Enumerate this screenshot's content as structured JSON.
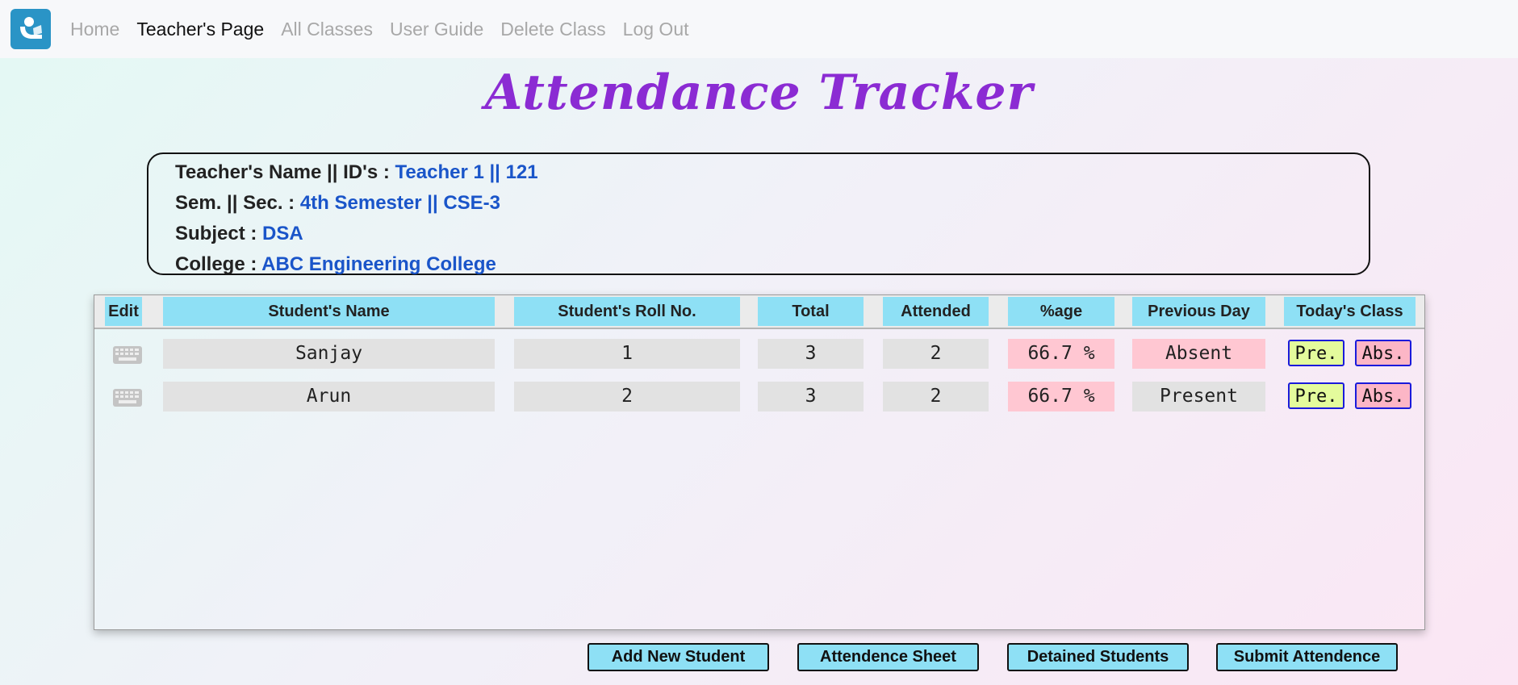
{
  "nav": {
    "home": "Home",
    "teachers_page": "Teacher's Page",
    "all_classes": "All Classes",
    "user_guide": "User Guide",
    "delete_class": "Delete Class",
    "log_out": "Log Out"
  },
  "page_title": "Attendance Tracker",
  "info": {
    "teacher_label": "Teacher's Name || ID's : ",
    "teacher_value": "Teacher 1 || 121",
    "sem_label": "Sem. || Sec. : ",
    "sem_value": "4th Semester || CSE-3",
    "subject_label": "Subject : ",
    "subject_value": "DSA",
    "college_label": "College : ",
    "college_value": "ABC Engineering College"
  },
  "table": {
    "headers": [
      "Edit",
      "Student's Name",
      "Student's Roll No.",
      "Total",
      "Attended",
      "%age",
      "Previous Day",
      "Today's Class"
    ],
    "rows": [
      {
        "name": "Sanjay",
        "roll": "1",
        "total": "3",
        "attended": "2",
        "percentage": "66.7 %",
        "previous_day": "Absent",
        "pre": "Pre.",
        "abs": "Abs."
      },
      {
        "name": "Arun",
        "roll": "2",
        "total": "3",
        "attended": "2",
        "percentage": "66.7 %",
        "previous_day": "Present",
        "pre": "Pre.",
        "abs": "Abs."
      }
    ]
  },
  "actions": {
    "add_student": "Add New Student",
    "attendance_sheet": "Attendence Sheet",
    "detained": "Detained Students",
    "submit": "Submit Attendence"
  },
  "colors": {
    "title": "#8b2bd3",
    "info_value": "#1a55c9",
    "header_bg": "#8ee0f5",
    "pink_cell": "#ffc7d2",
    "pre_button": "#e4fb9c",
    "abs_button": "#fcb6c6"
  },
  "icons": {
    "logo": "person-reading-logo",
    "edit": "keyboard-icon"
  }
}
